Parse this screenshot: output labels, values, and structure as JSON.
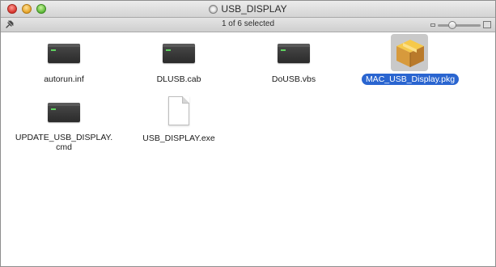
{
  "window": {
    "title": "USB_DISPLAY",
    "status": "1 of 6 selected"
  },
  "files": [
    {
      "name": "autorun.inf",
      "icon": "executable-icon",
      "selected": false
    },
    {
      "name": "DLUSB.cab",
      "icon": "executable-icon",
      "selected": false
    },
    {
      "name": "DoUSB.vbs",
      "icon": "executable-icon",
      "selected": false
    },
    {
      "name": "MAC_USB_Display.pkg",
      "icon": "package-icon",
      "selected": true
    },
    {
      "name": "UPDATE_USB_DISPLAY.cmd",
      "icon": "executable-icon",
      "selected": false
    },
    {
      "name": "USB_DISPLAY.exe",
      "icon": "document-icon",
      "selected": false
    }
  ],
  "colors": {
    "selection": "#2a65d0",
    "close": "#d6312a",
    "minimize": "#e5a123",
    "zoom": "#5bb737"
  }
}
